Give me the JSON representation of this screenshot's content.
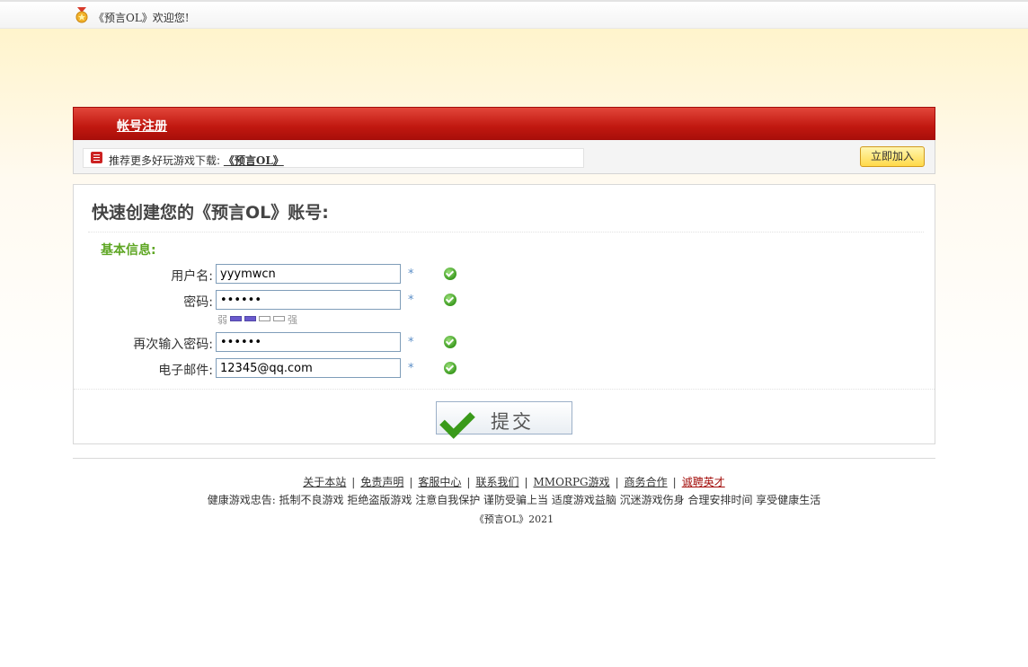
{
  "topbar": {
    "welcome": "《预言OL》欢迎您!",
    "icon": "medal-icon"
  },
  "header": {
    "title": "帐号注册"
  },
  "recommend": {
    "prefix": "推荐更多好玩游戏下载:",
    "game": "《预言OL》",
    "join_label": "立即加入"
  },
  "form": {
    "heading": "快速创建您的《预言OL》账号:",
    "section": "基本信息:",
    "fields": [
      {
        "label": "用户名:",
        "value": "yyymwcn",
        "star": "*"
      },
      {
        "label": "密码:",
        "value": "••••••",
        "star": "*"
      },
      {
        "label": "再次输入密码:",
        "value": "••••••",
        "star": "*"
      },
      {
        "label": "电子邮件:",
        "value": "12345@qq.com",
        "star": "*"
      }
    ],
    "strength": {
      "weak": "弱",
      "strong": "强",
      "level": 2,
      "max": 5
    },
    "submit_label": "提交"
  },
  "footer": {
    "links": [
      "关于本站",
      "免责声明",
      "客服中心",
      "联系我们",
      "MMORPG游戏",
      "商务合作",
      "诚聘英才"
    ],
    "separator": "|",
    "advice": "健康游戏忠告: 抵制不良游戏 拒绝盗版游戏 注意自我保护 谨防受骗上当 适度游戏益脑 沉迷游戏伤身 合理安排时间 享受健康生活",
    "copyright": "《预言OL》2021"
  },
  "colors": {
    "header_red": "#c11810",
    "section_green": "#5ea623",
    "accent_blue": "#5b8ec7"
  }
}
